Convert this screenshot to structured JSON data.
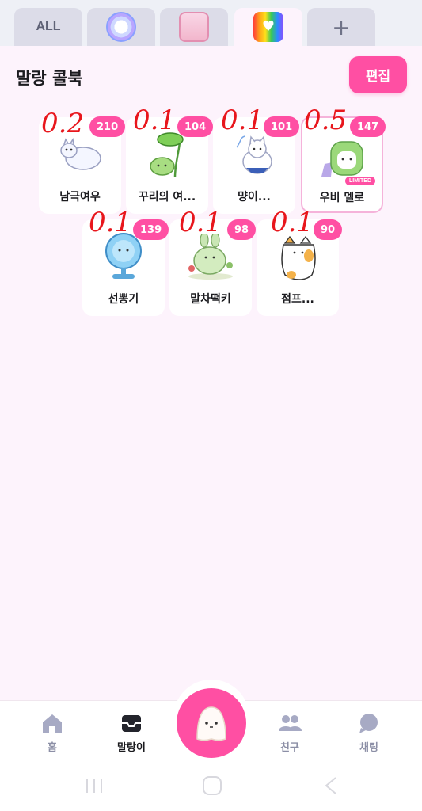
{
  "tabs": [
    {
      "label": "ALL",
      "active": false
    },
    {
      "icon": "astronaut-icon",
      "active": false
    },
    {
      "icon": "pink-box-icon",
      "active": false
    },
    {
      "icon": "rainbow-heart-icon",
      "active": true
    },
    {
      "icon": "plus-icon",
      "active": false
    }
  ],
  "tab_all_label": "ALL",
  "tab_plus_label": "+",
  "header": {
    "title": "말랑 콜북",
    "edit_label": "편집"
  },
  "cards": [
    {
      "name": "남극여우",
      "count": "210",
      "note": "0.2"
    },
    {
      "name": "꾸리의 여...",
      "count": "104",
      "note": "0.1"
    },
    {
      "name": "먕이...",
      "count": "101",
      "note": "0.1"
    },
    {
      "name": "우비 멜로",
      "count": "147",
      "note": "0.5",
      "tag": "LIMITED"
    },
    {
      "name": "선뽕기",
      "count": "139",
      "note": "0.1"
    },
    {
      "name": "말차떡키",
      "count": "98",
      "note": "0.1"
    },
    {
      "name": "점프...",
      "count": "90",
      "note": "0.1"
    }
  ],
  "nav": {
    "home": "홈",
    "malang": "말랑이",
    "friends": "친구",
    "chat": "채팅"
  },
  "colors": {
    "accent": "#ff4fa3",
    "background": "#fdf3fc"
  }
}
